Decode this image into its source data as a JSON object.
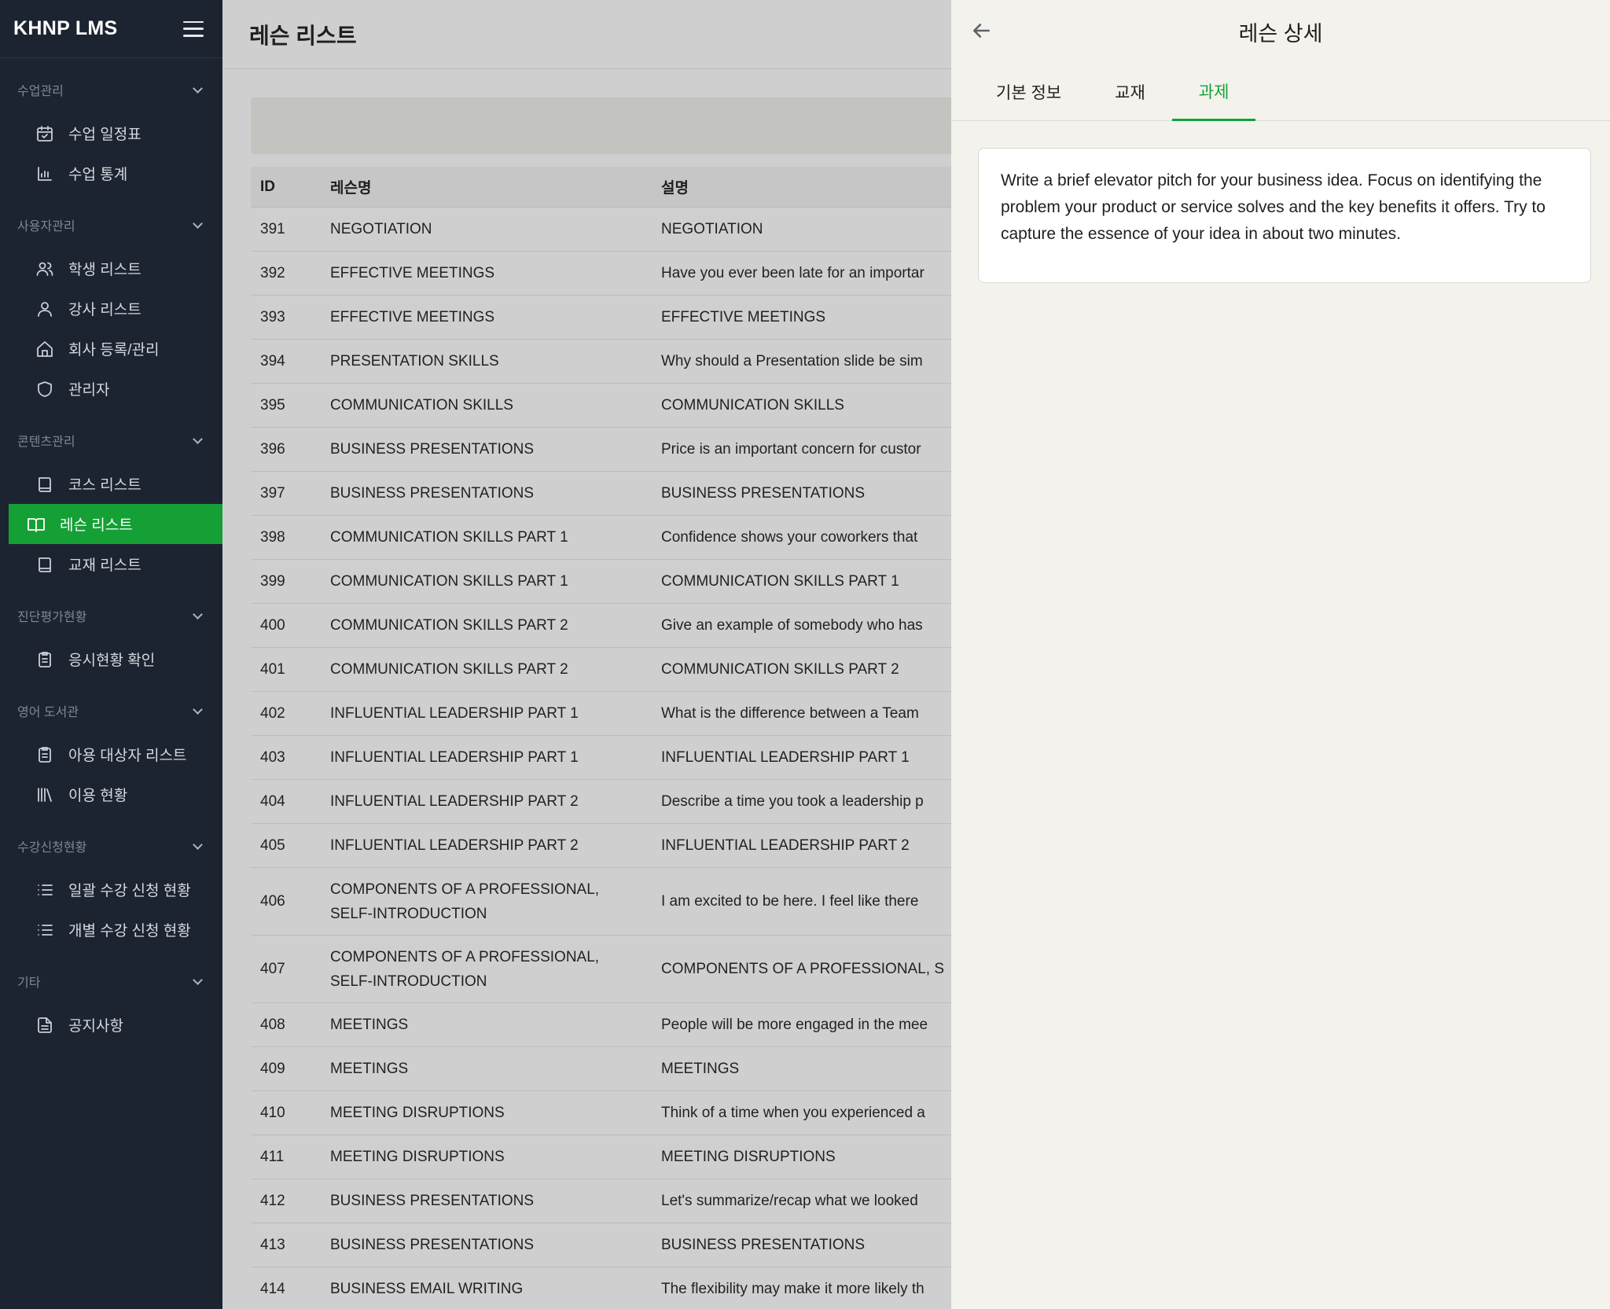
{
  "app": {
    "logo": "KHNP LMS"
  },
  "sidebar": {
    "sections": [
      {
        "title": "수업관리",
        "items": [
          {
            "label": "수업 일정표",
            "icon": "calendar-check-icon"
          },
          {
            "label": "수업 통계",
            "icon": "bar-chart-icon"
          }
        ]
      },
      {
        "title": "사용자관리",
        "items": [
          {
            "label": "학생 리스트",
            "icon": "users-icon"
          },
          {
            "label": "강사 리스트",
            "icon": "user-icon"
          },
          {
            "label": "회사 등록/관리",
            "icon": "home-icon"
          },
          {
            "label": "관리자",
            "icon": "shield-icon"
          }
        ]
      },
      {
        "title": "콘텐츠관리",
        "items": [
          {
            "label": "코스 리스트",
            "icon": "book-icon"
          },
          {
            "label": "레슨 리스트",
            "icon": "book-open-icon",
            "active": true
          },
          {
            "label": "교재 리스트",
            "icon": "book-icon"
          }
        ]
      },
      {
        "title": "진단평가현황",
        "items": [
          {
            "label": "응시현황 확인",
            "icon": "clipboard-icon"
          }
        ]
      },
      {
        "title": "영어 도서관",
        "items": [
          {
            "label": "아용 대상자 리스트",
            "icon": "clipboard-icon"
          },
          {
            "label": "이용 현황",
            "icon": "library-icon"
          }
        ]
      },
      {
        "title": "수강신청현황",
        "items": [
          {
            "label": "일괄 수강 신청 현황",
            "icon": "list-icon"
          },
          {
            "label": "개별 수강 신청 현황",
            "icon": "list-icon"
          }
        ]
      },
      {
        "title": "기타",
        "items": [
          {
            "label": "공지사항",
            "icon": "file-text-icon"
          }
        ]
      }
    ]
  },
  "main": {
    "title": "레슨 리스트",
    "table": {
      "headers": {
        "id": "ID",
        "name": "레슨명",
        "desc": "설명"
      },
      "rows": [
        {
          "id": "391",
          "name": "NEGOTIATION",
          "desc": "NEGOTIATION"
        },
        {
          "id": "392",
          "name": "EFFECTIVE MEETINGS",
          "desc": "Have you ever been late for an importar"
        },
        {
          "id": "393",
          "name": "EFFECTIVE MEETINGS",
          "desc": "EFFECTIVE MEETINGS"
        },
        {
          "id": "394",
          "name": "PRESENTATION SKILLS",
          "desc": "Why should a Presentation slide be sim"
        },
        {
          "id": "395",
          "name": "COMMUNICATION SKILLS",
          "desc": "COMMUNICATION SKILLS"
        },
        {
          "id": "396",
          "name": "BUSINESS PRESENTATIONS",
          "desc": "Price is an important concern for custor"
        },
        {
          "id": "397",
          "name": "BUSINESS PRESENTATIONS",
          "desc": "BUSINESS PRESENTATIONS"
        },
        {
          "id": "398",
          "name": "COMMUNICATION SKILLS PART 1",
          "desc": "Confidence shows your coworkers that"
        },
        {
          "id": "399",
          "name": "COMMUNICATION SKILLS PART 1",
          "desc": "COMMUNICATION SKILLS PART 1"
        },
        {
          "id": "400",
          "name": "COMMUNICATION SKILLS PART 2",
          "desc": "Give an example of somebody who has"
        },
        {
          "id": "401",
          "name": "COMMUNICATION SKILLS PART 2",
          "desc": "COMMUNICATION SKILLS PART 2"
        },
        {
          "id": "402",
          "name": "INFLUENTIAL LEADERSHIP PART 1",
          "desc": "What is the difference between a Team"
        },
        {
          "id": "403",
          "name": "INFLUENTIAL LEADERSHIP PART 1",
          "desc": "INFLUENTIAL LEADERSHIP PART 1"
        },
        {
          "id": "404",
          "name": "INFLUENTIAL LEADERSHIP PART 2",
          "desc": "Describe a time you took a leadership p"
        },
        {
          "id": "405",
          "name": "INFLUENTIAL LEADERSHIP PART 2",
          "desc": "INFLUENTIAL LEADERSHIP PART 2"
        },
        {
          "id": "406",
          "name": "COMPONENTS OF A PROFESSIONAL, SELF-INTRODUCTION",
          "desc": "I am excited to be here. I feel like there",
          "tall": true
        },
        {
          "id": "407",
          "name": "COMPONENTS OF A PROFESSIONAL, SELF-INTRODUCTION",
          "desc": "COMPONENTS OF A PROFESSIONAL, S",
          "tall": true
        },
        {
          "id": "408",
          "name": "MEETINGS",
          "desc": "People will be more engaged in the mee"
        },
        {
          "id": "409",
          "name": "MEETINGS",
          "desc": "MEETINGS"
        },
        {
          "id": "410",
          "name": "MEETING DISRUPTIONS",
          "desc": "Think of a time when you experienced a"
        },
        {
          "id": "411",
          "name": "MEETING DISRUPTIONS",
          "desc": "MEETING DISRUPTIONS"
        },
        {
          "id": "412",
          "name": "BUSINESS PRESENTATIONS",
          "desc": "Let's summarize/recap what we looked"
        },
        {
          "id": "413",
          "name": "BUSINESS PRESENTATIONS",
          "desc": "BUSINESS PRESENTATIONS"
        },
        {
          "id": "414",
          "name": "BUSINESS EMAIL WRITING",
          "desc": "The flexibility may make it more likely th"
        }
      ]
    }
  },
  "drawer": {
    "title": "레슨 상세",
    "tabs": [
      {
        "label": "기본 정보"
      },
      {
        "label": "교재"
      },
      {
        "label": "과제",
        "active": true
      }
    ],
    "assignment_text": "Write a brief elevator pitch for your business idea. Focus on identifying the problem your product or service solves and the key benefits it offers. Try to capture the essence of your idea in about two minutes."
  },
  "colors": {
    "sidebar_bg": "#1c2431",
    "accent_green": "#15a13a",
    "active_item_bg": "#14a035",
    "drawer_bg": "#f3f2ec"
  }
}
